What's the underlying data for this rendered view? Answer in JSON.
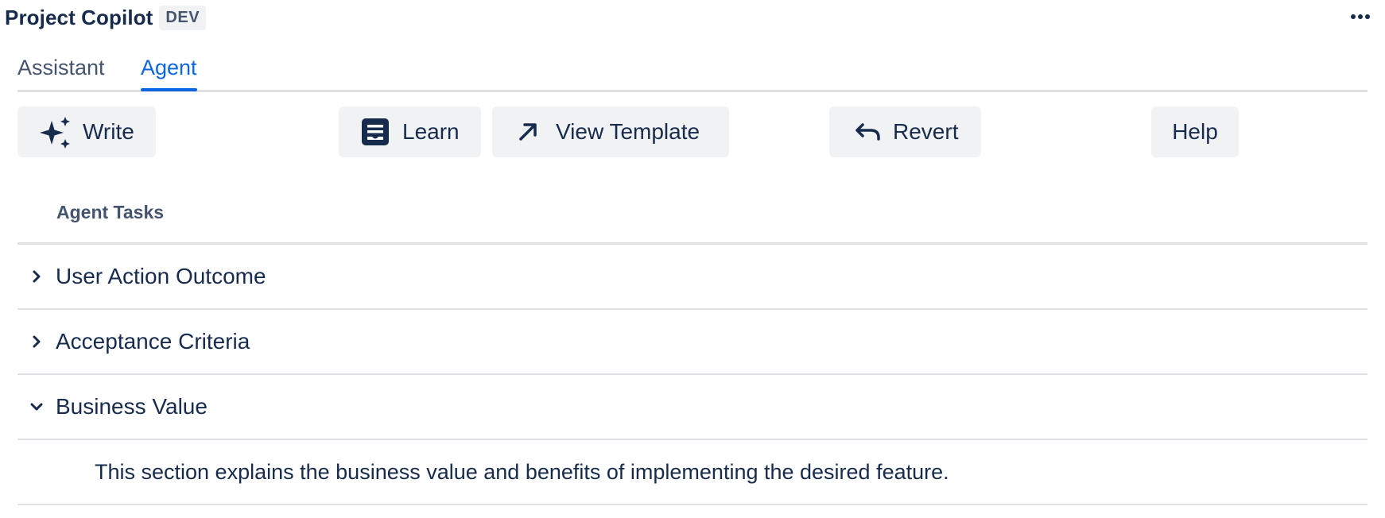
{
  "header": {
    "title": "Project Copilot",
    "badge": "DEV",
    "more_icon": "more-horizontal-icon"
  },
  "tabs": [
    {
      "label": "Assistant",
      "active": false
    },
    {
      "label": "Agent",
      "active": true
    }
  ],
  "toolbar": {
    "write": {
      "label": "Write",
      "icon": "sparkle-icon"
    },
    "learn": {
      "label": "Learn",
      "icon": "document-icon"
    },
    "view_template": {
      "label": "View Template",
      "icon": "arrow-up-right-icon"
    },
    "revert": {
      "label": "Revert",
      "icon": "undo-icon"
    },
    "help": {
      "label": "Help"
    }
  },
  "tasks": {
    "heading": "Agent Tasks",
    "items": [
      {
        "label": "User Action Outcome",
        "expanded": false
      },
      {
        "label": "Acceptance Criteria",
        "expanded": false
      },
      {
        "label": "Business Value",
        "expanded": true,
        "description": "This section explains the business value and benefits of implementing the desired feature."
      }
    ]
  },
  "colors": {
    "text": "#172b4d",
    "subtle_text": "#44546f",
    "accent": "#0c66e4",
    "button_bg": "#f1f2f4",
    "divider": "#dfe1e6"
  }
}
